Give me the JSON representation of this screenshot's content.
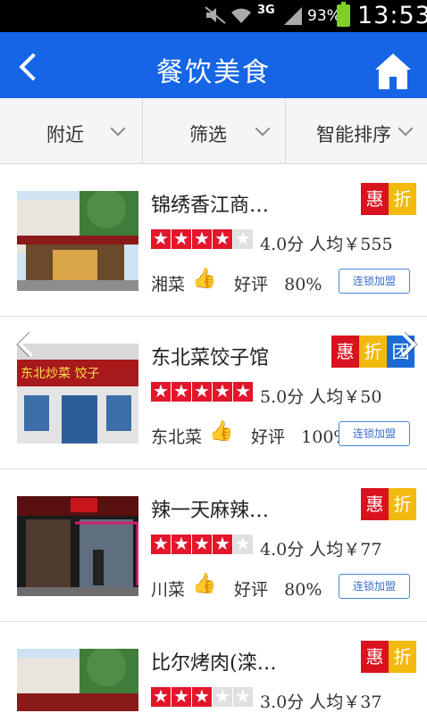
{
  "status_bar": {
    "network": "3G",
    "battery": "93%",
    "time": "13:53",
    "icons": [
      "mute-icon",
      "wifi-icon",
      "signal-icon",
      "battery-icon"
    ]
  },
  "header": {
    "title": "餐饮美食",
    "back_icon": "back-arrow-icon",
    "home_icon": "home-icon",
    "color": "#1565e6"
  },
  "filters": [
    {
      "label": "附近"
    },
    {
      "label": "筛选"
    },
    {
      "label": "智能排序"
    }
  ],
  "restaurants": [
    {
      "name": "锦绣香江商…",
      "rating": 4,
      "score": "4.0分",
      "avg": "人均￥555",
      "cuisine": "湘菜",
      "good_label": "好评",
      "good_pct": "80%",
      "button": "连锁加盟",
      "badges": [
        "惠",
        "折"
      ]
    },
    {
      "name": "东北菜饺子馆",
      "rating": 5,
      "score": "5.0分",
      "avg": "人均￥50",
      "cuisine": "东北菜",
      "good_label": "好评",
      "good_pct": "100%",
      "button": "连锁加盟",
      "badges": [
        "惠",
        "折",
        "团"
      ],
      "sign_text": "东北炒菜 饺子"
    },
    {
      "name": "辣一天麻辣…",
      "rating": 4,
      "score": "4.0分",
      "avg": "人均￥77",
      "cuisine": "川菜",
      "good_label": "好评",
      "good_pct": "80%",
      "button": "连锁加盟",
      "badges": [
        "惠",
        "折"
      ]
    },
    {
      "name": "比尔烤肉(滦…",
      "rating": 3,
      "score": "3.0分",
      "avg": "人均￥37",
      "cuisine": "",
      "good_label": "",
      "good_pct": "",
      "button": "",
      "badges": [
        "惠",
        "折"
      ]
    }
  ],
  "colors": {
    "star_on": "#e3162b",
    "badge_hui": "#d9121f",
    "badge_zhe": "#f2b90f",
    "badge_tuan": "#1c6ad8"
  }
}
